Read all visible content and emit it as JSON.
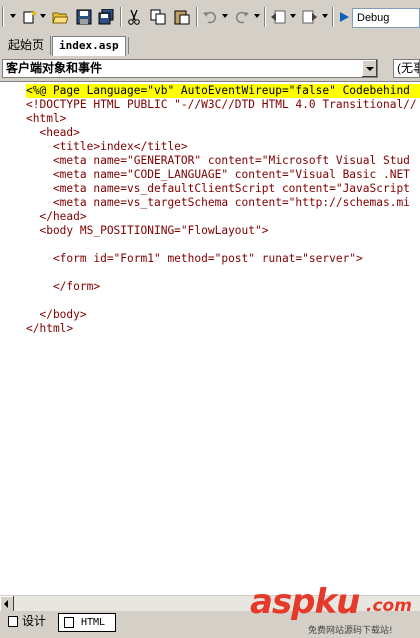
{
  "toolbar": {
    "buttons": [
      "new-project-icon",
      "new-item-icon",
      "open-icon",
      "save-icon",
      "save-all-icon",
      "cut-icon",
      "copy-icon",
      "paste-icon",
      "undo-icon",
      "redo-icon",
      "navigate-back-icon",
      "navigate-forward-icon",
      "start-icon"
    ],
    "configuration": "Debug"
  },
  "tabs": [
    {
      "label": "起始页",
      "active": false
    },
    {
      "label": "index.asp",
      "active": true
    }
  ],
  "object_dropdown": {
    "value": "客户端对象和事件"
  },
  "event_dropdown": {
    "value": "(无事"
  },
  "code_lines": [
    "<%@ Page Language=\"vb\" AutoEventWireup=\"false\" Codebehind",
    "<!DOCTYPE HTML PUBLIC \"-//W3C//DTD HTML 4.0 Transitional//",
    "<html>",
    "  <head>",
    "    <title>index</title>",
    "    <meta name=\"GENERATOR\" content=\"Microsoft Visual Stud",
    "    <meta name=\"CODE_LANGUAGE\" content=\"Visual Basic .NET",
    "    <meta name=vs_defaultClientScript content=\"JavaScript",
    "    <meta name=vs_targetSchema content=\"http://schemas.mi",
    "  </head>",
    "  <body MS_POSITIONING=\"FlowLayout\">",
    "",
    "    <form id=\"Form1\" method=\"post\" runat=\"server\">",
    "",
    "    </form>",
    "",
    "  </body>",
    "</html>"
  ],
  "view_tabs": {
    "design": "设计",
    "html": "HTML"
  },
  "watermark": {
    "logo": "aspku",
    "domain": ".com",
    "subtitle": "免费网站源码下载站!"
  },
  "colors": {
    "highlight": "#ffff00",
    "tag": "#800000",
    "attribute": "#ff0000",
    "value": "#0000ff",
    "text": "#000000",
    "chrome": "#d4d0c8"
  }
}
